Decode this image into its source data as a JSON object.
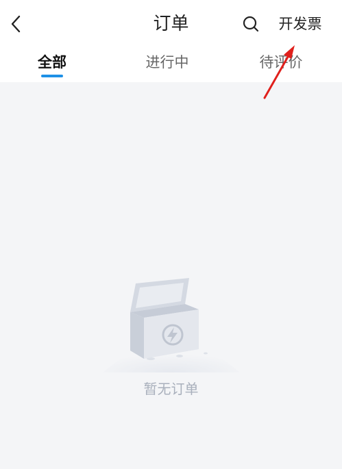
{
  "header": {
    "back_icon": "chevron-left-icon",
    "title": "订单",
    "search_icon": "search-icon",
    "invoice_label": "开发票"
  },
  "tabs": [
    {
      "label": "全部",
      "active": true
    },
    {
      "label": "进行中",
      "active": false
    },
    {
      "label": "待评价",
      "active": false
    }
  ],
  "empty_state": {
    "icon": "empty-box-icon",
    "message": "暂无订单"
  },
  "colors": {
    "accent": "#1e90e6",
    "page_background": "#f4f5f7",
    "annotation_arrow": "#e0201c"
  }
}
